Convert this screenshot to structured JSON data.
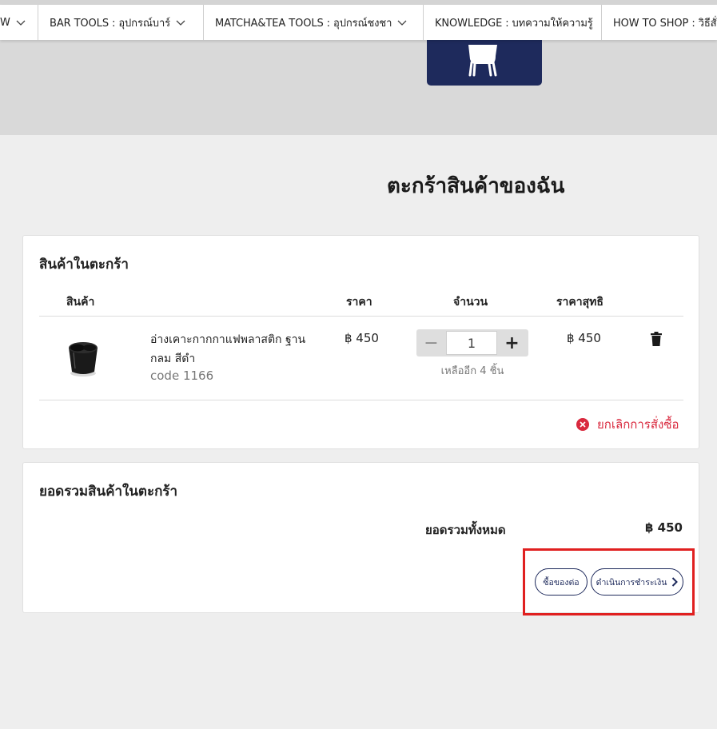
{
  "nav": {
    "items": [
      {
        "label": "W"
      },
      {
        "label": "BAR TOOLS : อุปกรณ์บาร์"
      },
      {
        "label": "MATCHA&TEA TOOLS : อุปกรณ์ชงชา"
      },
      {
        "label": "KNOWLEDGE : บทความให้ความรู้"
      },
      {
        "label": "HOW TO SHOP : วิธีสั่ง"
      }
    ]
  },
  "page": {
    "title": "ตะกร้าสินค้าของฉัน"
  },
  "cart": {
    "heading": "สินค้าในตะกร้า",
    "columns": {
      "product": "สินค้า",
      "price": "ราคา",
      "quantity": "จำนวน",
      "net_price": "ราคาสุทธิ"
    },
    "items": [
      {
        "name": "อ่างเคาะกากกาแฟพลาสติก ฐานกลม สีดำ",
        "code": "code 1166",
        "price": "฿ 450",
        "quantity": "1",
        "stock_note": "เหลืออีก 4 ชิ้น",
        "net_price": "฿ 450",
        "image_icon": "knock-box-black-icon"
      }
    ],
    "cancel_order_label": "ยกเลิกการสั่งซื้อ"
  },
  "summary": {
    "heading": "ยอดรวมสินค้าในตะกร้า",
    "total_label": "ยอดรวมทั้งหมด",
    "total_value": "฿ 450",
    "continue_shopping_label": "ซื้อของต่อ",
    "checkout_label": "ดำเนินการชำระเงิน"
  },
  "colors": {
    "brand_navy": "#1e2a5c",
    "cancel_red": "#d9293e",
    "highlight_red": "#e02020",
    "page_bg": "#eeeeee",
    "band_gray": "#d9d9d9"
  }
}
